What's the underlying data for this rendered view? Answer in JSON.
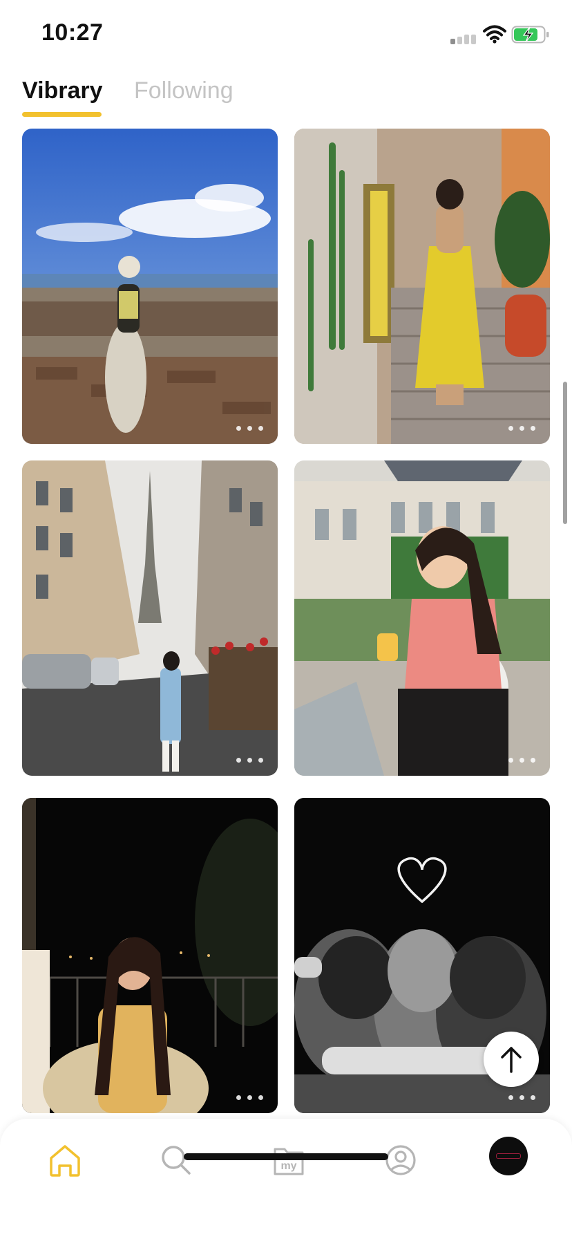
{
  "status_bar": {
    "time": "10:27",
    "signal_icon": "cellular-signal-icon",
    "wifi_icon": "wifi-icon",
    "battery_icon": "battery-charging-icon",
    "battery_color": "#35c759"
  },
  "tabs": [
    {
      "label": "Vibrary",
      "active": true
    },
    {
      "label": "Following",
      "active": false
    }
  ],
  "accent_color": "#f2c12e",
  "feed": {
    "posts": [
      {
        "scene": "woman in bucket hat sitting on stone ruins by the sea",
        "more_icon": "more-dots-icon"
      },
      {
        "scene": "woman in yellow dress on narrow stairway alley",
        "more_icon": "more-dots-icon"
      },
      {
        "scene": "street view towards the Eiffel Tower",
        "more_icon": "more-dots-icon"
      },
      {
        "scene": "woman in pink top holding a drink in a garden courtyard",
        "more_icon": "more-dots-icon"
      },
      {
        "scene": "woman in yellow top on a balcony at night",
        "more_icon": "more-dots-icon"
      },
      {
        "scene": "black and white photo of friends hugging under a heart",
        "more_icon": "more-dots-icon"
      }
    ]
  },
  "scroll_top_icon": "arrow-up-icon",
  "bottom_nav": {
    "items": [
      {
        "icon": "home-icon",
        "active": true
      },
      {
        "icon": "search-icon",
        "active": false
      },
      {
        "icon": "my-folder-icon",
        "label": "my",
        "active": false
      },
      {
        "icon": "profile-icon",
        "active": false
      },
      {
        "icon": "avatar-icon",
        "active": false
      }
    ],
    "active_color": "#f2c12e",
    "inactive_color": "#b5b5b5"
  }
}
